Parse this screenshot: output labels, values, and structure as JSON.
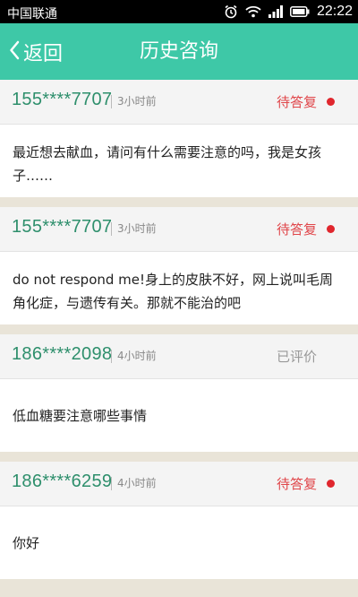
{
  "status_bar": {
    "carrier": "中国联通",
    "clock": "22:22",
    "icons": [
      "alarm-icon",
      "wifi-icon",
      "signal-icon",
      "battery-icon"
    ]
  },
  "nav": {
    "back_label": "返回",
    "title": "历史咨询"
  },
  "colors": {
    "accent": "#3ec8a7",
    "phone": "#2e8f6c",
    "pending": "#e0464a",
    "rated": "#999999"
  },
  "consultations": [
    {
      "phone": "155****7707",
      "time": "3小时前",
      "status": "待答复",
      "unread": true,
      "content": "最近想去献血，请问有什么需要注意的吗，我是女孩子……"
    },
    {
      "phone": "155****7707",
      "time": "3小时前",
      "status": "待答复",
      "unread": true,
      "content": "do not  respond me!身上的皮肤不好，网上说叫毛周角化症，与遗传有关。那就不能治的吧"
    },
    {
      "phone": "186****2098",
      "time": "4小时前",
      "status": "已评价",
      "unread": false,
      "content": "低血糖要注意哪些事情"
    },
    {
      "phone": "186****6259",
      "time": "4小时前",
      "status": "待答复",
      "unread": true,
      "content": "你好"
    }
  ]
}
